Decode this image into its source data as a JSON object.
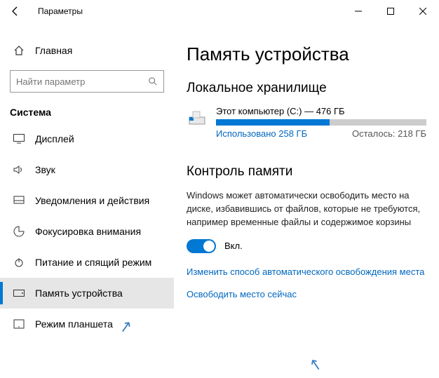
{
  "titlebar": {
    "title": "Параметры"
  },
  "sidebar": {
    "home": "Главная",
    "search_placeholder": "Найти параметр",
    "section": "Система",
    "items": [
      {
        "label": "Дисплей"
      },
      {
        "label": "Звук"
      },
      {
        "label": "Уведомления и действия"
      },
      {
        "label": "Фокусировка внимания"
      },
      {
        "label": "Питание и спящий режим"
      },
      {
        "label": "Память устройства"
      },
      {
        "label": "Режим планшета"
      }
    ]
  },
  "main": {
    "title": "Память устройства",
    "local_storage_heading": "Локальное хранилище",
    "drive": {
      "name": "Этот компьютер (C:) — 476 ГБ",
      "used_label": "Использовано 258 ГБ",
      "free_label": "Осталось: 218 ГБ"
    },
    "sense": {
      "heading": "Контроль памяти",
      "desc": "Windows может автоматически освободить место на диске, избавившись от файлов, которые не требуются, например временные файлы и содержимое корзины",
      "toggle_label": "Вкл.",
      "link1": "Изменить способ автоматического освобождения места",
      "link2": "Освободить место сейчас"
    }
  }
}
